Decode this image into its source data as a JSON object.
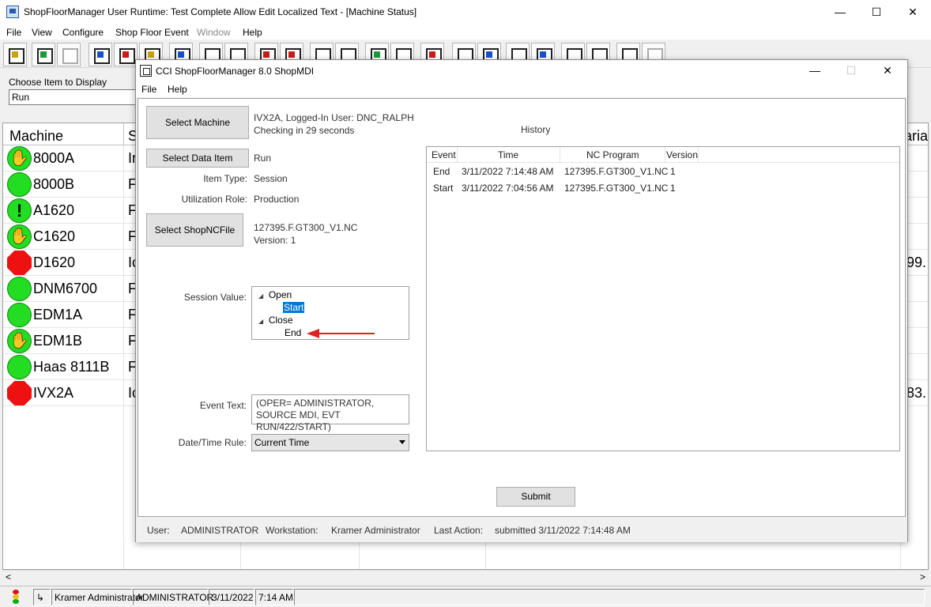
{
  "window": {
    "title": "ShopFloorManager User Runtime: Test Complete Allow Edit Localized Text - [Machine Status]",
    "minimize": "—",
    "maximize": "☐",
    "close": "✕"
  },
  "menu": [
    {
      "label": "File"
    },
    {
      "label": "View"
    },
    {
      "label": "Configure"
    },
    {
      "label": "Shop Floor Event"
    },
    {
      "label": "Window"
    },
    {
      "label": "Help"
    }
  ],
  "choose": {
    "label": "Choose Item to Display",
    "value": "Run"
  },
  "grid": {
    "headers": {
      "machine": "Machine",
      "status": "S",
      "variance": "aria"
    },
    "rows": [
      {
        "name": "8000A",
        "status": "hand",
        "col2": "Ir",
        "col3": ""
      },
      {
        "name": "8000B",
        "status": "green",
        "col2": "F",
        "col3": ""
      },
      {
        "name": "A1620",
        "status": "warn",
        "col2": "F",
        "col3": ""
      },
      {
        "name": "C1620",
        "status": "hand",
        "col2": "F",
        "col3": ""
      },
      {
        "name": "D1620",
        "status": "red",
        "col2": "Ic",
        "col3": "99."
      },
      {
        "name": "DNM6700",
        "status": "green",
        "col2": "F",
        "col3": ""
      },
      {
        "name": "EDM1A",
        "status": "green",
        "col2": "F",
        "col3": ""
      },
      {
        "name": "EDM1B",
        "status": "hand",
        "col2": "F",
        "col3": ""
      },
      {
        "name": "Haas 8111B",
        "status": "green",
        "col2": "F",
        "col3": ""
      },
      {
        "name": "IVX2A",
        "status": "red",
        "col2": "Ic",
        "col3": "83."
      }
    ]
  },
  "scroll": {
    "left": "<",
    "right": ">"
  },
  "statusbar": {
    "user_full": "Kramer Administrator",
    "user": "ADMINISTRATOR",
    "date": "3/11/2022",
    "time": "7:14 AM"
  },
  "dialog": {
    "title": "CCI ShopFloorManager 8.0 ShopMDI",
    "menu": [
      {
        "label": "File"
      },
      {
        "label": "Help"
      }
    ],
    "select_machine": "Select Machine",
    "machine_info": "IVX2A, Logged-In User: DNC_RALPH",
    "checking": "Checking in 29 seconds",
    "select_data_item": "Select Data Item",
    "data_item_value": "Run",
    "item_type_label": "Item Type:",
    "item_type_value": "Session",
    "util_role_label": "Utilization Role:",
    "util_role_value": "Production",
    "select_ncfile": "Select ShopNCFile",
    "ncfile_name": "127395.F.GT300_V1.NC",
    "ncfile_version": "Version: 1",
    "session_value_label": "Session Value:",
    "tree": {
      "open": "Open",
      "start": "Start",
      "close": "Close",
      "end": "End"
    },
    "event_text_label": "Event Text:",
    "event_text": "(OPER= ADMINISTRATOR, SOURCE MDI, EVT RUN/422/START)",
    "datetime_rule_label": "Date/Time Rule:",
    "datetime_rule_value": "Current Time",
    "history": {
      "title": "History",
      "columns": [
        "Event",
        "Time",
        "NC Program",
        "Version"
      ],
      "rows": [
        {
          "event": "End",
          "time": "3/11/2022 7:14:48 AM",
          "program": "127395.F.GT300_V1.NC",
          "version": "1"
        },
        {
          "event": "Start",
          "time": "3/11/2022 7:04:56 AM",
          "program": "127395.F.GT300_V1.NC",
          "version": "1"
        }
      ]
    },
    "submit": "Submit",
    "status": {
      "user_label": "User:",
      "user_value": "ADMINISTRATOR",
      "workstation_label": "Workstation:",
      "workstation_value": "Kramer Administrator",
      "last_action_label": "Last Action:",
      "last_action_value": "submitted 3/11/2022 7:14:48 AM"
    }
  },
  "colors": {
    "status_green": "#22dd22",
    "status_red": "#ee1111",
    "selection": "#0078d7",
    "annotation_arrow": "#e02020"
  }
}
